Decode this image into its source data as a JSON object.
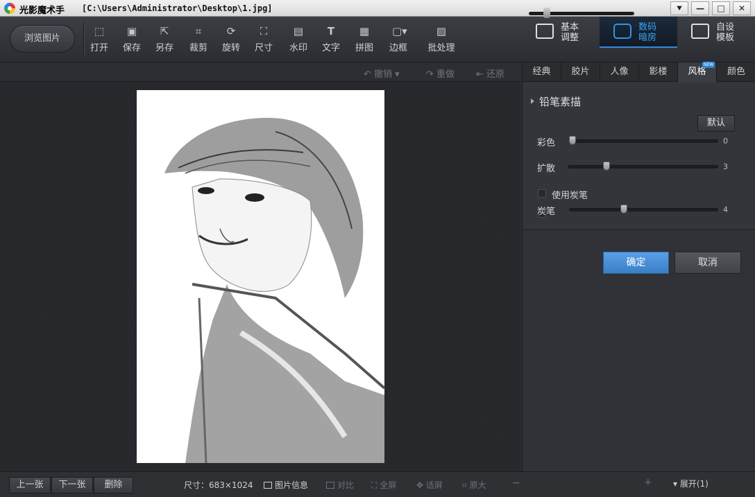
{
  "window": {
    "app_name": "光影魔术手",
    "file_path": "[C:\\Users\\Administrator\\Desktop\\1.jpg]",
    "buttons": [
      "⯆",
      "—",
      "□",
      "✕"
    ]
  },
  "toolbar": {
    "browse_label": "浏览图片",
    "tools": [
      {
        "label": "打开",
        "icon": "open-image-icon"
      },
      {
        "label": "保存",
        "icon": "save-icon"
      },
      {
        "label": "另存",
        "icon": "save-as-icon"
      },
      {
        "label": "裁剪",
        "icon": "crop-icon"
      },
      {
        "label": "旋转",
        "icon": "rotate-icon"
      },
      {
        "label": "尺寸",
        "icon": "resize-icon"
      },
      {
        "label": "水印",
        "icon": "watermark-icon"
      },
      {
        "label": "文字",
        "icon": "text-icon"
      },
      {
        "label": "拼图",
        "icon": "collage-icon"
      },
      {
        "label": "边框",
        "icon": "frame-icon"
      },
      {
        "label": "批处理",
        "icon": "batch-icon"
      }
    ],
    "modes": [
      {
        "line1": "基本",
        "line2": "调整",
        "icon": "basic-adjust-icon"
      },
      {
        "line1": "数码",
        "line2": "暗房",
        "icon": "camera-icon"
      },
      {
        "line1": "自设",
        "line2": "模板",
        "icon": "printer-icon"
      }
    ]
  },
  "history": {
    "undo": "撤销",
    "redo": "重做",
    "restore": "还原"
  },
  "panel": {
    "tabs": [
      "经典",
      "胶片",
      "人像",
      "影楼",
      "风格",
      "颜色"
    ],
    "active_tab": "风格",
    "new_badge": "NEW",
    "effect_name": "铅笔素描",
    "default_label": "默认",
    "sliders": [
      {
        "label": "彩色",
        "value": "0",
        "fraction": 0.0
      },
      {
        "label": "扩散",
        "value": "3",
        "fraction": 0.24
      },
      {
        "label": "炭笔",
        "value": "4",
        "fraction": 0.36
      }
    ],
    "charcoal_checkbox": "使用炭笔",
    "ok": "确定",
    "cancel": "取消"
  },
  "status": {
    "prev": "上一张",
    "next": "下一张",
    "delete": "删除",
    "size": "尺寸：683×1024",
    "info": "图片信息",
    "compare": "对比",
    "fullscreen": "全屏",
    "fit": "适屏",
    "original": "原大",
    "zoom_minus": "−",
    "zoom_plus": "+",
    "expand": "展开(1)",
    "zoom_fraction": 0.15
  },
  "colors": {
    "accent": "#3aa3ff",
    "ok_button": "#4a8fd6"
  }
}
